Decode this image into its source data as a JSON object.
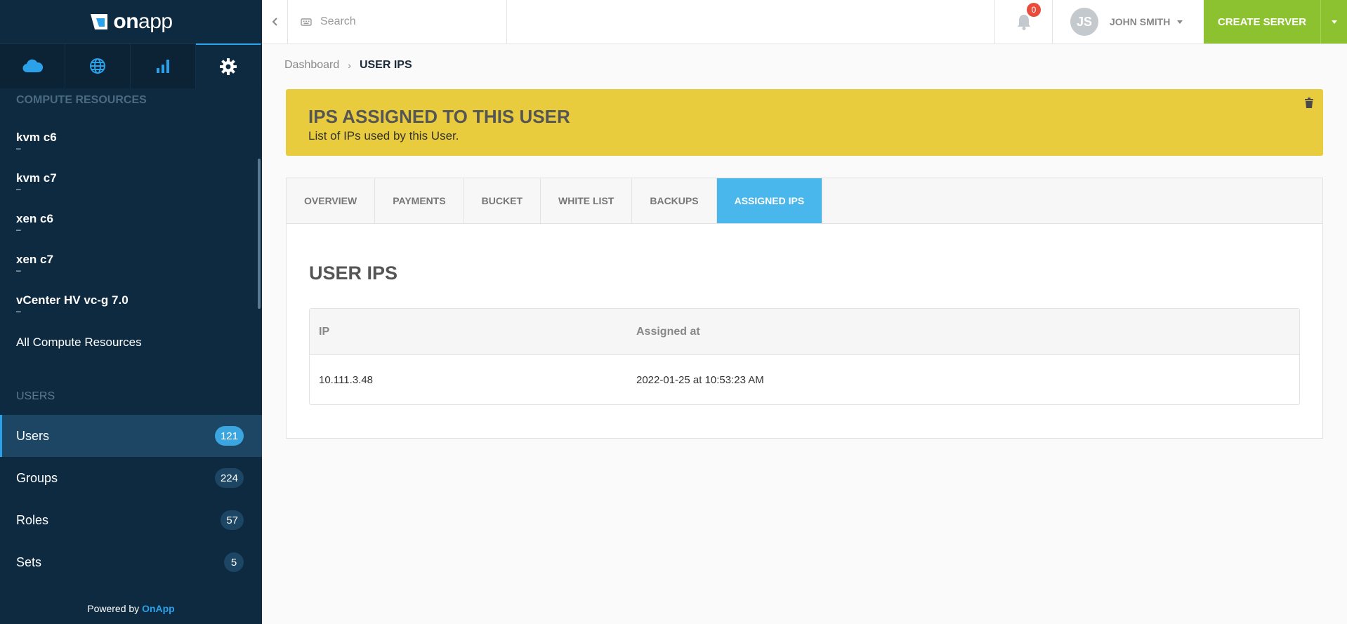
{
  "brand": {
    "logo_text_on": "on",
    "logo_text_app": "app"
  },
  "sidebar": {
    "icon_tabs": [
      {
        "icon": "cloud-icon",
        "active": false
      },
      {
        "icon": "globe-icon",
        "active": false
      },
      {
        "icon": "bar-chart-icon",
        "active": false
      },
      {
        "icon": "gear-icon",
        "active": true
      }
    ],
    "compute_resources_title": "COMPUTE RESOURCES",
    "compute_resources": [
      {
        "name": "kvm c6",
        "sub": "–"
      },
      {
        "name": "kvm c7",
        "sub": "–"
      },
      {
        "name": "xen c6",
        "sub": "–"
      },
      {
        "name": "xen c7",
        "sub": "–"
      },
      {
        "name": "vCenter HV vc-g 7.0",
        "sub": "–"
      }
    ],
    "all_compute_resources": "All Compute Resources",
    "users_title": "USERS",
    "menu": [
      {
        "label": "Users",
        "count": "121",
        "active": true
      },
      {
        "label": "Groups",
        "count": "224",
        "active": false
      },
      {
        "label": "Roles",
        "count": "57",
        "active": false
      },
      {
        "label": "Sets",
        "count": "5",
        "active": false
      }
    ],
    "powered_by": "Powered by",
    "powered_brand": "OnApp"
  },
  "topbar": {
    "search_placeholder": "Search",
    "notification_count": "0",
    "user_initials": "JS",
    "user_name": "JOHN SMITH",
    "create_label": "CREATE SERVER"
  },
  "breadcrumb": {
    "root": "Dashboard",
    "separator": "›",
    "current": "USER IPS"
  },
  "banner": {
    "title": "IPS ASSIGNED TO THIS USER",
    "subtitle": "List of IPs used by this User."
  },
  "tabs": [
    {
      "label": "OVERVIEW",
      "active": false
    },
    {
      "label": "PAYMENTS",
      "active": false
    },
    {
      "label": "BUCKET",
      "active": false
    },
    {
      "label": "WHITE LIST",
      "active": false
    },
    {
      "label": "BACKUPS",
      "active": false
    },
    {
      "label": "ASSIGNED IPS",
      "active": true
    }
  ],
  "section_title": "USER IPS",
  "table": {
    "headers": [
      "IP",
      "Assigned at"
    ],
    "rows": [
      [
        "10.111.3.48",
        "2022-01-25 at 10:53:23 AM"
      ]
    ]
  },
  "colors": {
    "sidebar_bg": "#0e2a40",
    "accent_blue": "#2aa1e8",
    "banner_yellow": "#e9cc3e",
    "create_green": "#8cc230",
    "active_tab": "#49b6ec"
  }
}
